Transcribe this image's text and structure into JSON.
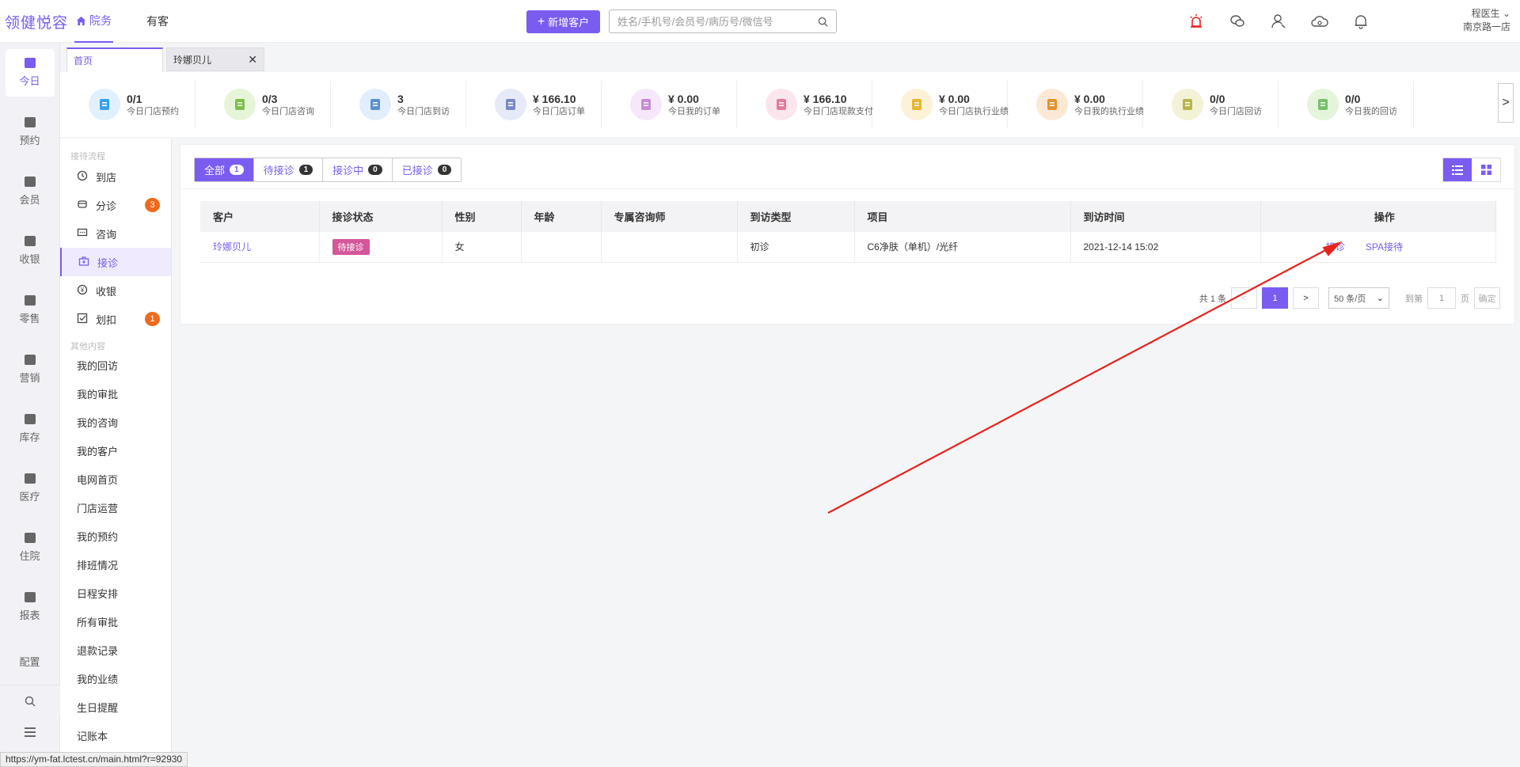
{
  "app": {
    "logo": "领健悦容",
    "user_name": "程医生",
    "user_store": "南京路一店"
  },
  "top_nav": [
    {
      "label": "院务",
      "active": true
    },
    {
      "label": "有客",
      "active": false
    }
  ],
  "add_button": "新增客户",
  "search": {
    "placeholder": "姓名/手机号/会员号/病历号/微信号"
  },
  "top_icons": [
    "alarm-icon",
    "wechat-icon",
    "user-settings-icon",
    "cloud-icon",
    "bell-icon"
  ],
  "sidebar": [
    {
      "label": "今日",
      "active": true
    },
    {
      "label": "预约"
    },
    {
      "label": "会员"
    },
    {
      "label": "收银"
    },
    {
      "label": "零售"
    },
    {
      "label": "营销"
    },
    {
      "label": "库存"
    },
    {
      "label": "医疗"
    },
    {
      "label": "住院"
    },
    {
      "label": "报表"
    },
    {
      "label": "配置"
    }
  ],
  "tabs": [
    {
      "label": "首页",
      "active": true
    },
    {
      "label": "玲娜贝儿",
      "closable": true
    }
  ],
  "stats": [
    {
      "value": "0/1",
      "label": "今日门店预约",
      "bg": "#e0f1fd",
      "fg": "#3aa0e8"
    },
    {
      "value": "0/3",
      "label": "今日门店咨询",
      "bg": "#e6f5d8",
      "fg": "#7cc04a"
    },
    {
      "value": "3",
      "label": "今日门店到访",
      "bg": "#e3eefc",
      "fg": "#5b8fd8"
    },
    {
      "value": "¥ 166.10",
      "label": "今日门店订单",
      "bg": "#e6eaf8",
      "fg": "#7a88c8"
    },
    {
      "value": "¥ 0.00",
      "label": "今日我的订单",
      "bg": "#f6e8fa",
      "fg": "#c78ad8"
    },
    {
      "value": "¥ 166.10",
      "label": "今日门店现款支付",
      "bg": "#fce6ee",
      "fg": "#e67a9e"
    },
    {
      "value": "¥ 0.00",
      "label": "今日门店执行业绩",
      "bg": "#fdf1d8",
      "fg": "#eab52e"
    },
    {
      "value": "¥ 0.00",
      "label": "今日我的执行业绩",
      "bg": "#fbe9d6",
      "fg": "#e4922f"
    },
    {
      "value": "0/0",
      "label": "今日门店回访",
      "bg": "#f3f2d6",
      "fg": "#b8b54a"
    },
    {
      "value": "0/0",
      "label": "今日我的回访",
      "bg": "#e4f5dc",
      "fg": "#76c26a"
    }
  ],
  "stats_next": ">",
  "menu": {
    "group1": "接待流程",
    "flow": [
      {
        "label": "到店",
        "icon": "clock-icon"
      },
      {
        "label": "分诊",
        "icon": "triage-icon",
        "badge": "3"
      },
      {
        "label": "咨询",
        "icon": "chat-icon"
      },
      {
        "label": "接诊",
        "icon": "medical-kit-icon",
        "active": true
      },
      {
        "label": "收银",
        "icon": "cashier-icon"
      },
      {
        "label": "划扣",
        "icon": "check-square-icon",
        "badge": "1"
      }
    ],
    "group2": "其他内容",
    "others": [
      "我的回访",
      "我的审批",
      "我的咨询",
      "我的客户",
      "电网首页",
      "门店运营",
      "我的预约",
      "排班情况",
      "日程安排",
      "所有审批",
      "退款记录",
      "我的业绩",
      "生日提醒",
      "记账本"
    ]
  },
  "filters": [
    {
      "label": "全部",
      "count": "1",
      "active": true
    },
    {
      "label": "待接诊",
      "count": "1"
    },
    {
      "label": "接诊中",
      "count": "0"
    },
    {
      "label": "已接诊",
      "count": "0"
    }
  ],
  "table": {
    "headers": [
      "客户",
      "接诊状态",
      "性别",
      "年龄",
      "专属咨询师",
      "到访类型",
      "项目",
      "到访时间",
      "操作"
    ],
    "rows": [
      {
        "customer": "玲娜贝儿",
        "status": "待接诊",
        "gender": "女",
        "age": "",
        "consultant": "",
        "visit_type": "初诊",
        "project": "C6净肤（单机）/光纤",
        "visit_time": "2021-12-14 15:02",
        "op1": "接诊",
        "op2": "SPA接待"
      }
    ]
  },
  "pagination": {
    "total": "共 1 条",
    "prev": "<",
    "current": "1",
    "next": ">",
    "page_size": "50 条/页",
    "goto_label": "到第",
    "goto_value": "1",
    "page_unit": "页",
    "confirm": "确定"
  },
  "status_url": "https://ym-fat.lctest.cn/main.html?r=92930",
  "colors": {
    "accent": "#7b5cf0",
    "badge": "#ef6a1a",
    "status_pending": "#d4569b",
    "arrow": "#e8231c"
  }
}
